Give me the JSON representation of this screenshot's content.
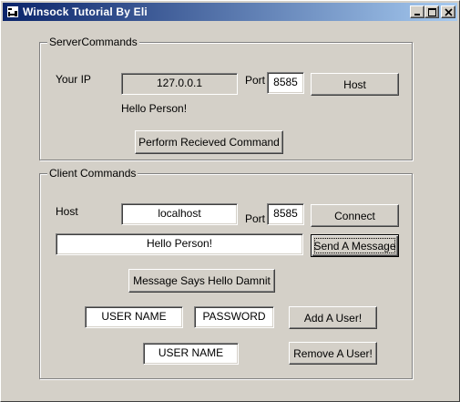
{
  "window": {
    "title": "Winsock Tutorial By Eli",
    "minimize": "minimize",
    "maximize": "maximize",
    "close": "close"
  },
  "server": {
    "group_label": "ServerCommands",
    "your_ip_label": "Your IP",
    "ip_value": "127.0.0.1",
    "port_label": "Port",
    "port_value": "8585",
    "host_button": "Host",
    "message_label": "Hello Person!",
    "perform_button": "Perform Recieved Command"
  },
  "client": {
    "group_label": "Client Commands",
    "host_label": "Host",
    "host_value": "localhost",
    "port_label": "Port",
    "port_value": "8585",
    "connect_button": "Connect",
    "message_value": "Hello Person!",
    "send_button": "Send A Message",
    "hello_button": "Message Says Hello Damnit",
    "username_value": "USER NAME",
    "password_value": "PASSWORD",
    "add_user_button": "Add A User!",
    "remove_username_value": "USER NAME",
    "remove_user_button": "Remove A User!"
  }
}
